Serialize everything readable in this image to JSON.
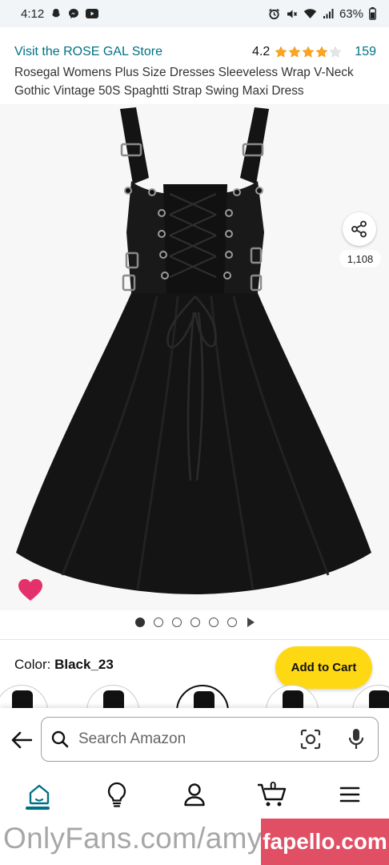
{
  "status_bar": {
    "time": "4:12",
    "battery": "63%",
    "icons_left": [
      "snapchat-icon",
      "messenger-icon",
      "youtube-icon"
    ],
    "icons_right": [
      "alarm-icon",
      "mute-icon",
      "wifi-icon",
      "signal-icon",
      "battery-icon"
    ]
  },
  "header": {
    "store_link": "Visit the ROSE GAL Store",
    "rating": "4.2",
    "rating_value": 4.2,
    "review_count": "159",
    "title": "Rosegal Womens Plus Size Dresses Sleeveless Wrap V-Neck Gothic Vintage 50S Spaghtti Strap Swing Maxi Dress"
  },
  "image": {
    "share_count": "1,108",
    "pager": {
      "total": 6,
      "active": 0,
      "has_video": true
    }
  },
  "product": {
    "color_label": "Color:",
    "color_value": "Black_23",
    "add_to_cart": "Add to Cart"
  },
  "search": {
    "placeholder": "Search Amazon"
  },
  "nav": {
    "cart_count": "0",
    "items": [
      "home-icon",
      "lightbulb-icon",
      "account-icon",
      "cart-icon",
      "menu-icon"
    ]
  },
  "watermarks": {
    "left": "OnlyFans.com/amyvinsani",
    "right": "fapello.com"
  },
  "colors": {
    "link": "#007185",
    "star": "#ffa41c",
    "cart_button": "#ffd814",
    "heart": "#e3326b",
    "active_nav": "#007185"
  }
}
